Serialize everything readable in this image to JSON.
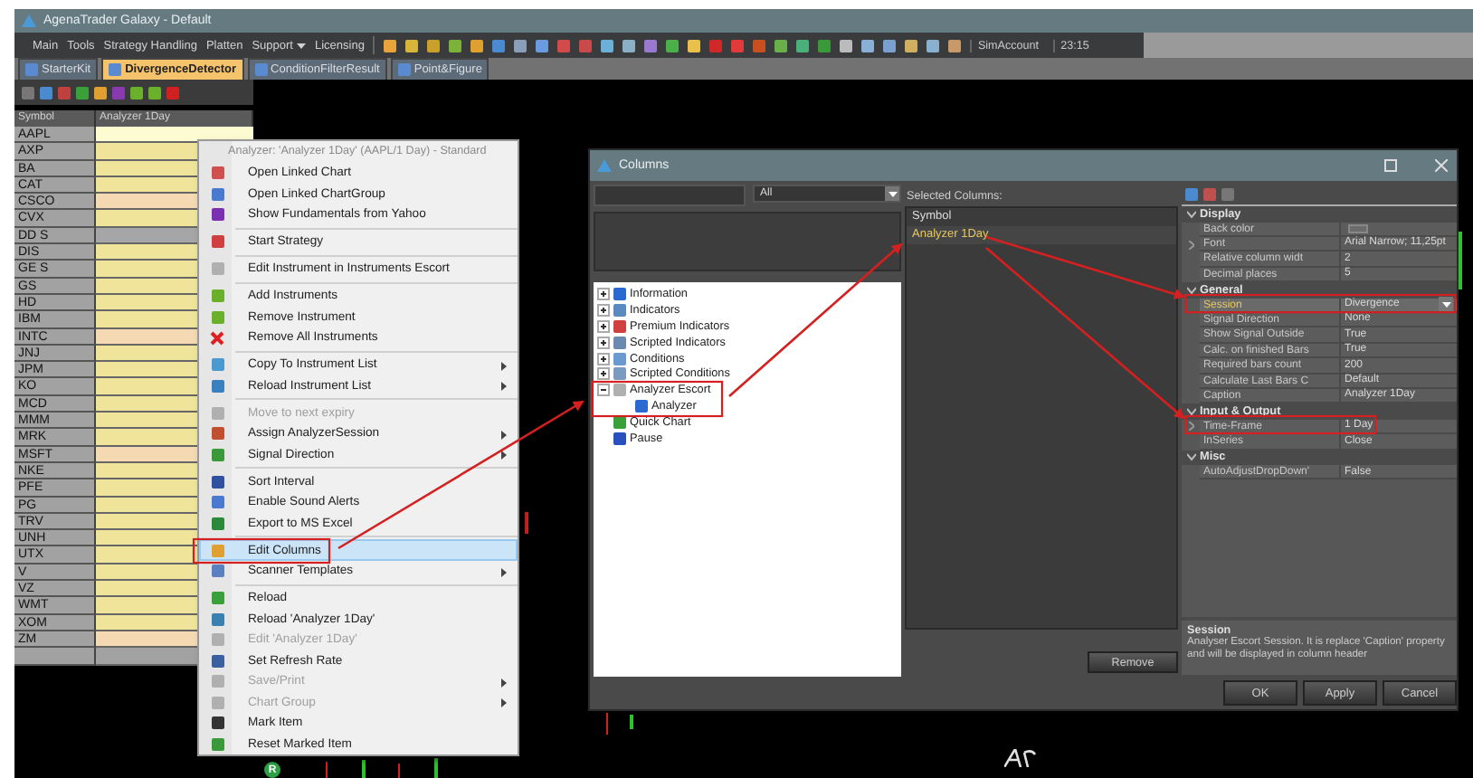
{
  "window": {
    "title": "AgenaTrader Galaxy - Default"
  },
  "menu": [
    {
      "label": "Main",
      "dropdown": false
    },
    {
      "label": "Tools",
      "dropdown": false
    },
    {
      "label": "Strategy Handling",
      "dropdown": false
    },
    {
      "label": "Platten",
      "dropdown": false
    },
    {
      "label": "Support",
      "dropdown": true
    },
    {
      "label": "Licensing",
      "dropdown": false
    }
  ],
  "account": "SimAccount",
  "clock": "23:15",
  "tabs": [
    {
      "label": "StarterKit",
      "selected": false
    },
    {
      "label": "DivergenceDetector",
      "selected": true
    },
    {
      "label": "ConditionFilterResult",
      "selected": false
    },
    {
      "label": "Point&Figure",
      "selected": false
    }
  ],
  "scanner": {
    "columns": [
      "Symbol",
      "Analyzer 1Day"
    ],
    "rows": [
      {
        "symbol": "AAPL",
        "color": "#fdfbd2"
      },
      {
        "symbol": "AXP",
        "color": "#efe49a"
      },
      {
        "symbol": "BA",
        "color": "#efe49a"
      },
      {
        "symbol": "CAT",
        "color": "#efe49a"
      },
      {
        "symbol": "CSCO",
        "color": "#f4d9b2"
      },
      {
        "symbol": "CVX",
        "color": "#efe49a"
      },
      {
        "symbol": "DD S",
        "color": "#a6a6a6"
      },
      {
        "symbol": "DIS",
        "color": "#efe49a"
      },
      {
        "symbol": "GE S",
        "color": "#efe49a"
      },
      {
        "symbol": "GS",
        "color": "#efe49a"
      },
      {
        "symbol": "HD",
        "color": "#efe49a"
      },
      {
        "symbol": "IBM",
        "color": "#efe49a"
      },
      {
        "symbol": "INTC",
        "color": "#f4d9b2"
      },
      {
        "symbol": "JNJ",
        "color": "#efe49a"
      },
      {
        "symbol": "JPM",
        "color": "#efe49a"
      },
      {
        "symbol": "KO",
        "color": "#efe49a"
      },
      {
        "symbol": "MCD",
        "color": "#efe49a"
      },
      {
        "symbol": "MMM",
        "color": "#efe49a"
      },
      {
        "symbol": "MRK",
        "color": "#efe49a"
      },
      {
        "symbol": "MSFT",
        "color": "#f4d9b2"
      },
      {
        "symbol": "NKE",
        "color": "#efe49a"
      },
      {
        "symbol": "PFE",
        "color": "#efe49a"
      },
      {
        "symbol": "PG",
        "color": "#efe49a"
      },
      {
        "symbol": "TRV",
        "color": "#efe49a"
      },
      {
        "symbol": "UNH",
        "color": "#efe49a"
      },
      {
        "symbol": "UTX",
        "color": "#efe49a"
      },
      {
        "symbol": "V",
        "color": "#efe49a"
      },
      {
        "symbol": "VZ",
        "color": "#efe49a"
      },
      {
        "symbol": "WMT",
        "color": "#efe49a"
      },
      {
        "symbol": "XOM",
        "color": "#efe49a"
      },
      {
        "symbol": "ZM",
        "color": "#f4d9b2"
      }
    ]
  },
  "context_menu": {
    "header": "Analyzer: 'Analyzer 1Day' (AAPL/1 Day) - Standard",
    "items": [
      {
        "kind": "item",
        "label": "Open Linked Chart",
        "disabled": false,
        "selected": false,
        "submenu": false
      },
      {
        "kind": "item",
        "label": "Open Linked ChartGroup",
        "disabled": false,
        "selected": false,
        "submenu": false
      },
      {
        "kind": "item",
        "label": "Show Fundamentals from Yahoo",
        "disabled": false,
        "selected": false,
        "submenu": false
      },
      {
        "kind": "separator"
      },
      {
        "kind": "item",
        "label": "Start Strategy",
        "disabled": false,
        "selected": false,
        "submenu": false
      },
      {
        "kind": "separator"
      },
      {
        "kind": "item",
        "label": "Edit Instrument in Instruments Escort",
        "disabled": false,
        "selected": false,
        "submenu": false
      },
      {
        "kind": "separator"
      },
      {
        "kind": "item",
        "label": "Add Instruments",
        "disabled": false,
        "selected": false,
        "submenu": false
      },
      {
        "kind": "item",
        "label": "Remove Instrument",
        "disabled": false,
        "selected": false,
        "submenu": false
      },
      {
        "kind": "item",
        "label": "Remove All Instruments",
        "disabled": false,
        "selected": false,
        "submenu": false
      },
      {
        "kind": "separator"
      },
      {
        "kind": "item",
        "label": "Copy To Instrument List",
        "disabled": false,
        "selected": false,
        "submenu": true
      },
      {
        "kind": "item",
        "label": "Reload Instrument List",
        "disabled": false,
        "selected": false,
        "submenu": true
      },
      {
        "kind": "separator"
      },
      {
        "kind": "item",
        "label": "Move to next expiry",
        "disabled": true,
        "selected": false,
        "submenu": false
      },
      {
        "kind": "item",
        "label": "Assign AnalyzerSession",
        "disabled": false,
        "selected": false,
        "submenu": true
      },
      {
        "kind": "item",
        "label": "Signal Direction",
        "disabled": false,
        "selected": false,
        "submenu": true
      },
      {
        "kind": "separator"
      },
      {
        "kind": "item",
        "label": "Sort Interval",
        "disabled": false,
        "selected": false,
        "submenu": false
      },
      {
        "kind": "item",
        "label": "Enable Sound Alerts",
        "disabled": false,
        "selected": false,
        "submenu": false
      },
      {
        "kind": "item",
        "label": "Export to MS Excel",
        "disabled": false,
        "selected": false,
        "submenu": false
      },
      {
        "kind": "separator"
      },
      {
        "kind": "item",
        "label": "Edit Columns",
        "disabled": false,
        "selected": true,
        "submenu": false
      },
      {
        "kind": "item",
        "label": "Scanner Templates",
        "disabled": false,
        "selected": false,
        "submenu": true
      },
      {
        "kind": "separator"
      },
      {
        "kind": "item",
        "label": "Reload",
        "disabled": false,
        "selected": false,
        "submenu": false
      },
      {
        "kind": "item",
        "label": "Reload 'Analyzer 1Day'",
        "disabled": false,
        "selected": false,
        "submenu": false
      },
      {
        "kind": "item",
        "label": "Edit 'Analyzer 1Day'",
        "disabled": true,
        "selected": false,
        "submenu": false
      },
      {
        "kind": "item",
        "label": "Set Refresh Rate",
        "disabled": false,
        "selected": false,
        "submenu": false
      },
      {
        "kind": "item",
        "label": "Save/Print",
        "disabled": true,
        "selected": false,
        "submenu": true
      },
      {
        "kind": "item",
        "label": "Chart Group",
        "disabled": true,
        "selected": false,
        "submenu": true
      },
      {
        "kind": "item",
        "label": "Mark Item",
        "disabled": false,
        "selected": false,
        "submenu": false
      },
      {
        "kind": "item",
        "label": "Reset Marked Item",
        "disabled": false,
        "selected": false,
        "submenu": false
      }
    ]
  },
  "columns_dialog": {
    "title": "Columns",
    "filter": "All",
    "tree": [
      {
        "label": "Information",
        "kind": "group",
        "expanded": false
      },
      {
        "label": "Indicators",
        "kind": "group",
        "expanded": false
      },
      {
        "label": "Premium Indicators",
        "kind": "group",
        "expanded": false
      },
      {
        "label": "Scripted Indicators",
        "kind": "group",
        "expanded": false
      },
      {
        "label": "Conditions",
        "kind": "group",
        "expanded": false
      },
      {
        "label": "Scripted Conditions",
        "kind": "group",
        "expanded": false
      },
      {
        "label": "Analyzer Escort",
        "kind": "group",
        "expanded": true,
        "children": [
          {
            "label": "Analyzer",
            "kind": "leaf"
          }
        ]
      },
      {
        "label": "Quick Chart",
        "kind": "leaf"
      },
      {
        "label": "Pause",
        "kind": "leaf"
      }
    ],
    "selected_columns_label": "Selected Columns:",
    "selected_columns": [
      {
        "label": "Symbol",
        "selected": false
      },
      {
        "label": "Analyzer 1Day",
        "selected": true
      }
    ],
    "remove_button": "Remove",
    "properties": [
      {
        "category": "Display",
        "expanded": true,
        "rows": [
          {
            "name": "Back color",
            "kind": "swatch",
            "expandable": false,
            "selected": false
          },
          {
            "name": "Font",
            "value": "Arial Narrow; 11,25pt",
            "kind": "text",
            "expandable": true,
            "selected": false
          },
          {
            "name": "Relative column widt",
            "value": "2",
            "kind": "text",
            "expandable": false,
            "selected": false
          },
          {
            "name": "Decimal places",
            "value": "5",
            "kind": "text",
            "expandable": false,
            "selected": false
          }
        ]
      },
      {
        "category": "General",
        "expanded": true,
        "rows": [
          {
            "name": "Session",
            "value": "Divergence",
            "kind": "dropdown",
            "expandable": false,
            "selected": true
          },
          {
            "name": "Signal Direction",
            "value": "None",
            "kind": "text",
            "expandable": false,
            "selected": false
          },
          {
            "name": "Show Signal Outside",
            "value": "True",
            "kind": "text",
            "expandable": false,
            "selected": false
          },
          {
            "name": "Calc. on finished Bars",
            "value": "True",
            "kind": "text",
            "expandable": false,
            "selected": false
          },
          {
            "name": "Required bars count",
            "value": "200",
            "kind": "text",
            "expandable": false,
            "selected": false
          },
          {
            "name": "Calculate Last Bars C",
            "value": "Default",
            "kind": "text",
            "expandable": false,
            "selected": false
          },
          {
            "name": "Caption",
            "value": "Analyzer 1Day",
            "kind": "text",
            "expandable": false,
            "selected": false
          }
        ]
      },
      {
        "category": "Input & Output",
        "expanded": true,
        "rows": [
          {
            "name": "Time-Frame",
            "value": "1 Day",
            "kind": "text",
            "expandable": true,
            "selected": false
          },
          {
            "name": "InSeries",
            "value": "Close",
            "kind": "text",
            "expandable": false,
            "selected": false
          }
        ]
      },
      {
        "category": "Misc",
        "expanded": true,
        "rows": [
          {
            "name": "AutoAdjustDropDown'",
            "value": "False",
            "kind": "text",
            "expandable": false,
            "selected": false
          }
        ]
      }
    ],
    "description": {
      "title": "Session",
      "text": "Analyser Escort Session. It is replace 'Caption' property and will be displayed in column header"
    },
    "buttons": [
      "OK",
      "Apply",
      "Cancel"
    ]
  },
  "chart": {
    "badge": "R"
  }
}
